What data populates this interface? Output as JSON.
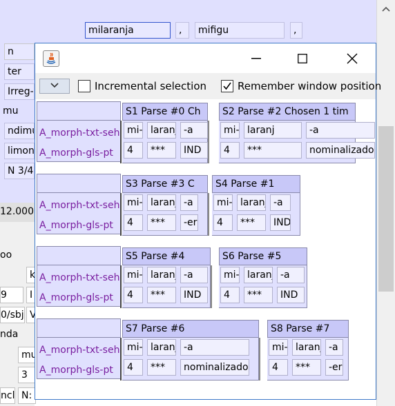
{
  "background": {
    "row_inputs": [
      "milaranja",
      ",",
      "mifigu",
      ","
    ],
    "left_fields": [
      "n",
      "ter",
      "Irreg-i",
      "mu",
      "ndimu",
      "limone",
      "N 3/4",
      "12.000",
      "oo",
      "k",
      "9",
      "I",
      "0/sbj",
      "V",
      "nda",
      "mu",
      "3",
      "ncl",
      "N:"
    ]
  },
  "dialog": {
    "title_icon": "java-icon",
    "minimize_label": "—",
    "maximize_label": "☐",
    "close_label": "✕",
    "toolbar": {
      "dropdown_icon": "chevron-down-icon",
      "incremental_selection_label": "Incremental selection",
      "incremental_selection_checked": false,
      "remember_position_label": "Remember window position",
      "remember_position_checked": true
    },
    "row_labels": [
      "A_morph-txt-seh",
      "A_morph-gls-pt"
    ],
    "groups": [
      {
        "parses": [
          {
            "header": "S1 Parse #0 Ch",
            "txt": [
              "mi-",
              "laranj",
              "-a"
            ],
            "gls": [
              "4",
              "***",
              "IND"
            ]
          },
          {
            "header": "S2 Parse #2 Chosen 1 tim",
            "txt": [
              "mi-",
              "laranj",
              "-a"
            ],
            "gls": [
              "4",
              "***",
              "nominalizador"
            ]
          }
        ]
      },
      {
        "parses": [
          {
            "header": "S3 Parse #3 C",
            "txt": [
              "mi-",
              "laranj",
              "-a"
            ],
            "gls": [
              "4",
              "***",
              "-er"
            ]
          },
          {
            "header": "S4 Parse #1",
            "txt": [
              "mi-",
              "laranj",
              "-a"
            ],
            "gls": [
              "4",
              "***",
              "IND"
            ]
          }
        ]
      },
      {
        "parses": [
          {
            "header": "S5 Parse #4",
            "txt": [
              "mi-",
              "laranj",
              "-a"
            ],
            "gls": [
              "4",
              "***",
              "IND"
            ]
          },
          {
            "header": "S6 Parse #5",
            "txt": [
              "mi-",
              "laranj",
              "-a"
            ],
            "gls": [
              "4",
              "***",
              "IND"
            ]
          }
        ]
      },
      {
        "parses": [
          {
            "header": "S7 Parse #6",
            "txt": [
              "mi-",
              "laranj",
              "-a"
            ],
            "gls": [
              "4",
              "***",
              "nominalizador"
            ]
          },
          {
            "header": "S8 Parse #7",
            "txt": [
              "mi-",
              "laranj",
              "-a"
            ],
            "gls": [
              "4",
              "***",
              "-er"
            ]
          }
        ]
      }
    ]
  }
}
